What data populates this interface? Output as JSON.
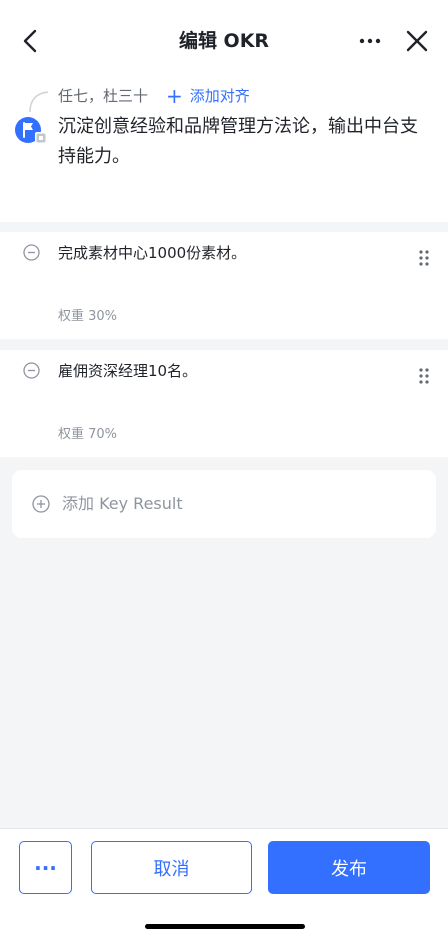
{
  "header": {
    "title": "编辑 OKR",
    "back_icon": "chevron-left-icon",
    "more_icon": "more-horizontal-icon",
    "close_icon": "close-icon"
  },
  "objective": {
    "assignees": "任七，杜三十",
    "add_alignment_label": "添加对齐",
    "text": "沉淀创意经验和品牌管理方法论，输出中台支持能力。",
    "icon": "objective-flag-icon"
  },
  "key_results": [
    {
      "text": "完成素材中心1000份素材。",
      "weight": "权重 30%"
    },
    {
      "text": "雇佣资深经理10名。",
      "weight": "权重 70%"
    }
  ],
  "add_key_result": {
    "label": "添加 Key Result"
  },
  "footer": {
    "more_label": "···",
    "cancel_label": "取消",
    "publish_label": "发布"
  },
  "colors": {
    "accent": "#3370ff",
    "background": "#f4f5f7",
    "text_primary": "#1f2329",
    "text_secondary": "#8f959e"
  }
}
